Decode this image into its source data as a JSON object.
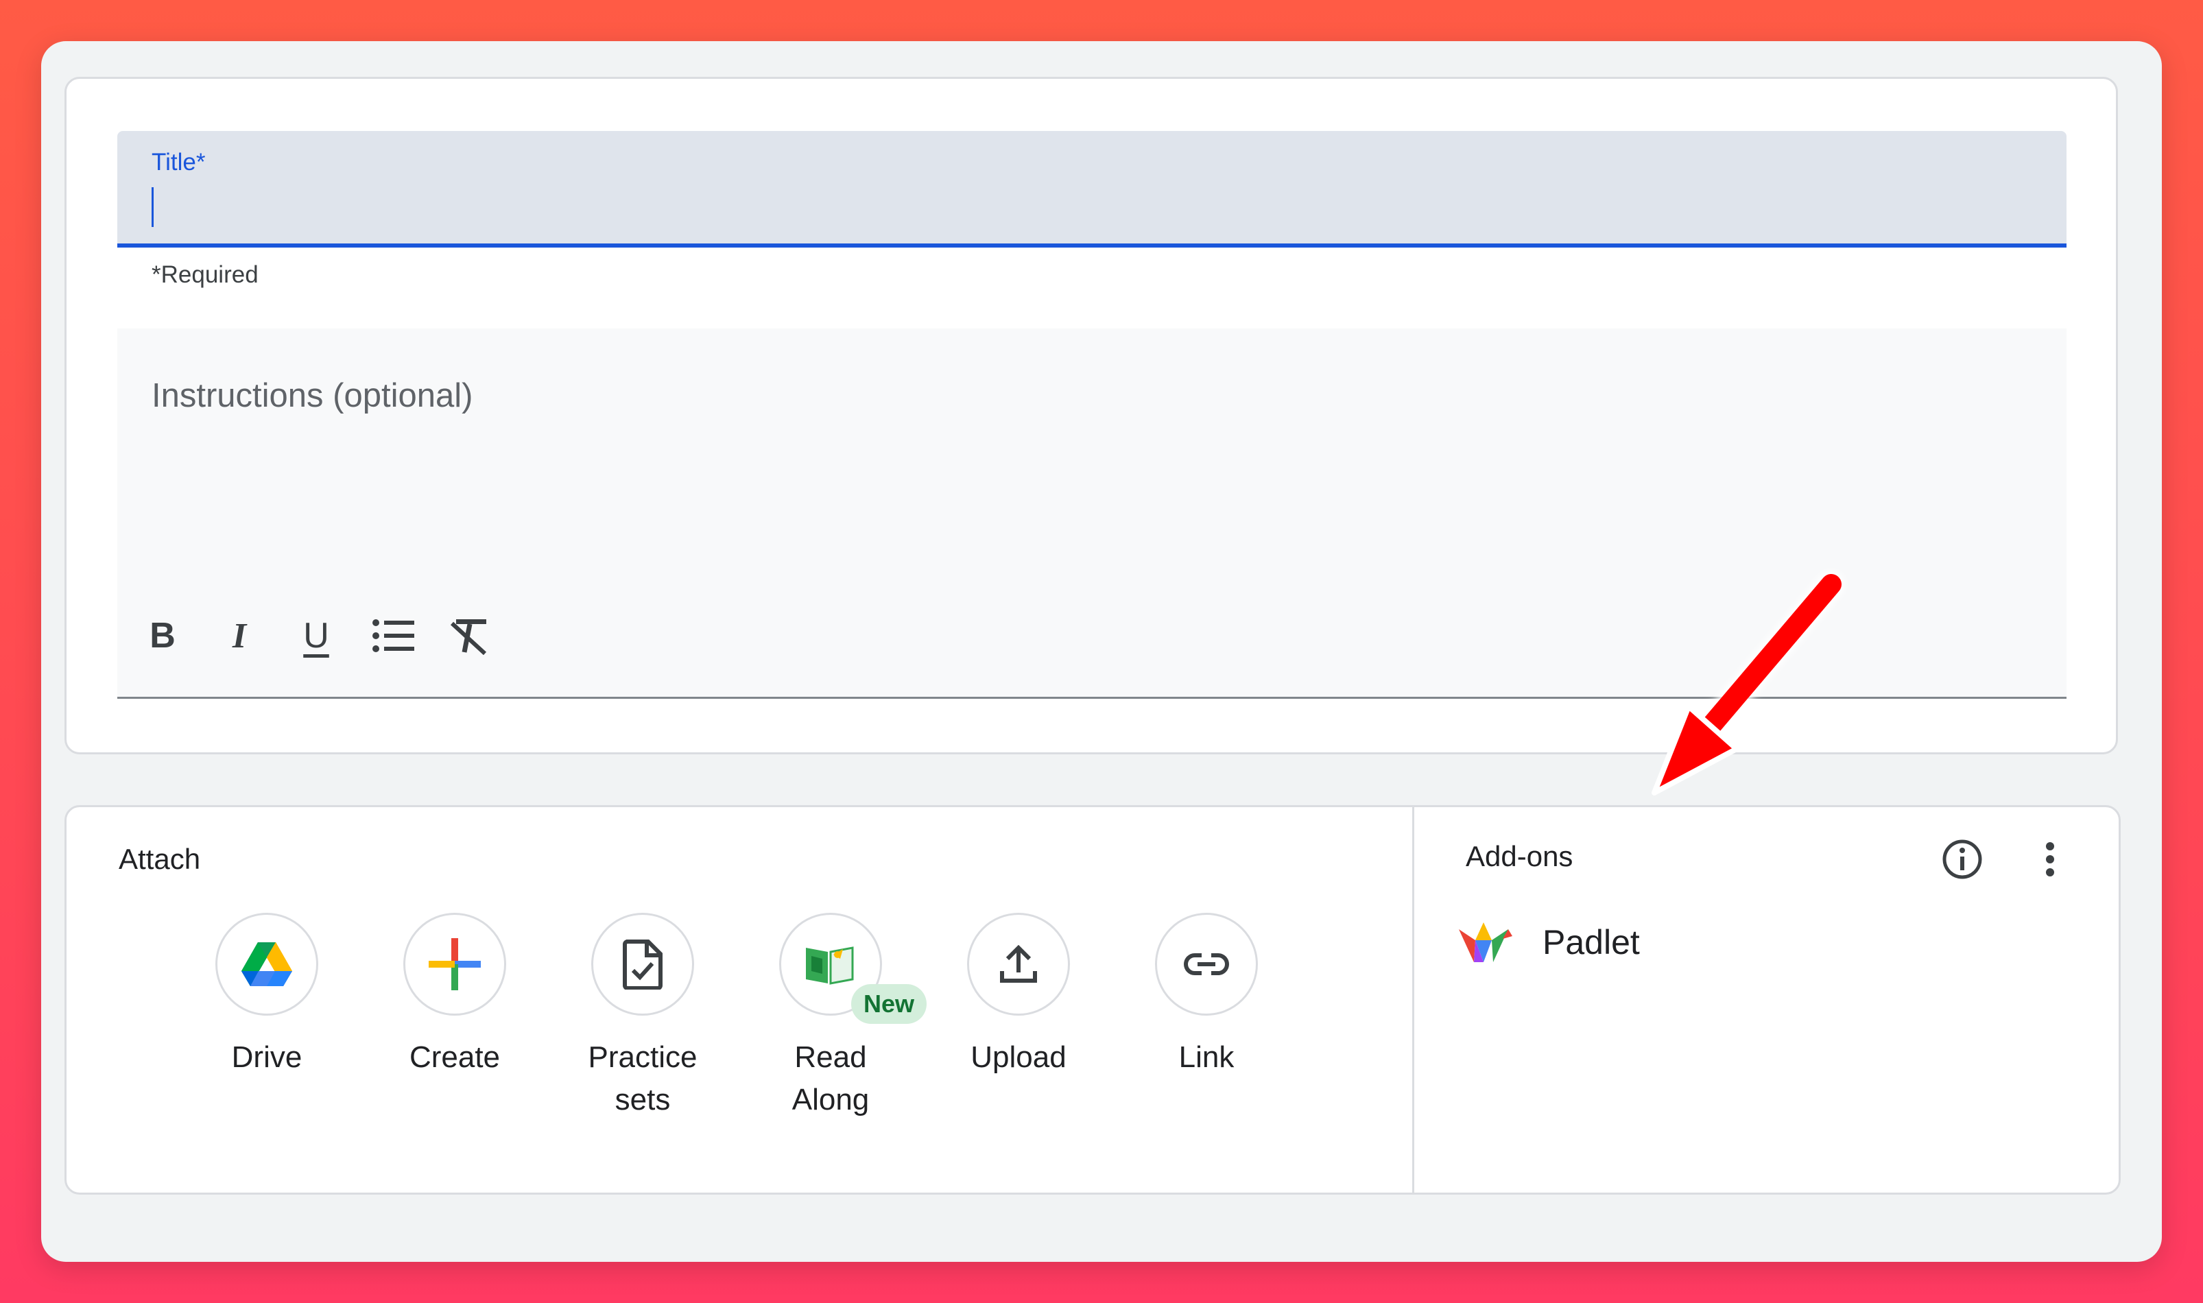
{
  "form": {
    "title_label": "Title*",
    "title_value": "",
    "required_note": "*Required",
    "instructions_placeholder": "Instructions (optional)",
    "toolbar": [
      {
        "name": "bold-icon",
        "label": "B"
      },
      {
        "name": "italic-icon",
        "label": "I"
      },
      {
        "name": "underline-icon",
        "label": "U"
      },
      {
        "name": "bulleted-list-icon"
      },
      {
        "name": "clear-formatting-icon"
      }
    ]
  },
  "attach": {
    "title": "Attach",
    "items": [
      {
        "label": "Drive",
        "icon": "google-drive-icon"
      },
      {
        "label": "Create",
        "icon": "plus-icon"
      },
      {
        "label": "Practice\nsets",
        "icon": "practice-sets-icon"
      },
      {
        "label": "Read\nAlong",
        "icon": "read-along-icon",
        "badge": "New"
      },
      {
        "label": "Upload",
        "icon": "upload-icon"
      },
      {
        "label": "Link",
        "icon": "link-icon"
      }
    ]
  },
  "addons": {
    "title": "Add-ons",
    "items": [
      {
        "label": "Padlet",
        "icon": "padlet-icon"
      }
    ]
  },
  "colors": {
    "accent_blue": "#1a56db",
    "annotation_arrow": "#ff0000",
    "new_badge_bg": "#d3eedb",
    "new_badge_text": "#137333"
  }
}
